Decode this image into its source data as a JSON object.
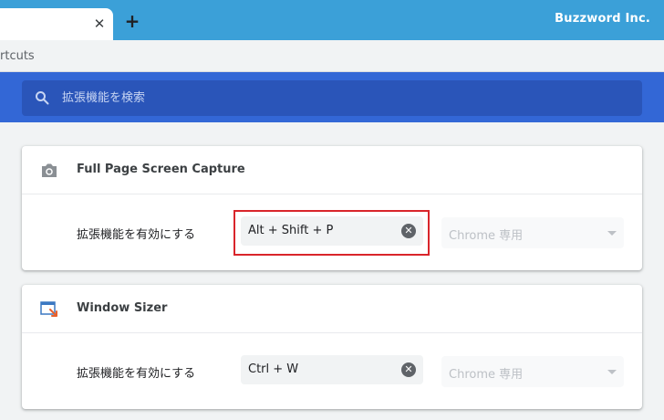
{
  "tab": {
    "close_glyph": "✕",
    "new_tab_glyph": "+"
  },
  "brand": "Buzzword Inc.",
  "address": {
    "text": "rtcuts"
  },
  "search": {
    "placeholder": "拡張機能を検索",
    "icon": "search-icon"
  },
  "extensions": [
    {
      "name": "Full Page Screen Capture",
      "icon": "camera-icon",
      "row_label": "拡張機能を有効にする",
      "shortcut": "Alt + Shift + P",
      "scope": "Chrome 専用",
      "highlighted": true
    },
    {
      "name": "Window Sizer",
      "icon": "window-resize-icon",
      "row_label": "拡張機能を有効にする",
      "shortcut": "Ctrl + W",
      "scope": "Chrome 専用",
      "highlighted": false
    }
  ],
  "colors": {
    "tabstrip": "#3ba0d8",
    "header": "#3367d6",
    "search_bg": "#2a55b9",
    "highlight": "#d9252b"
  }
}
